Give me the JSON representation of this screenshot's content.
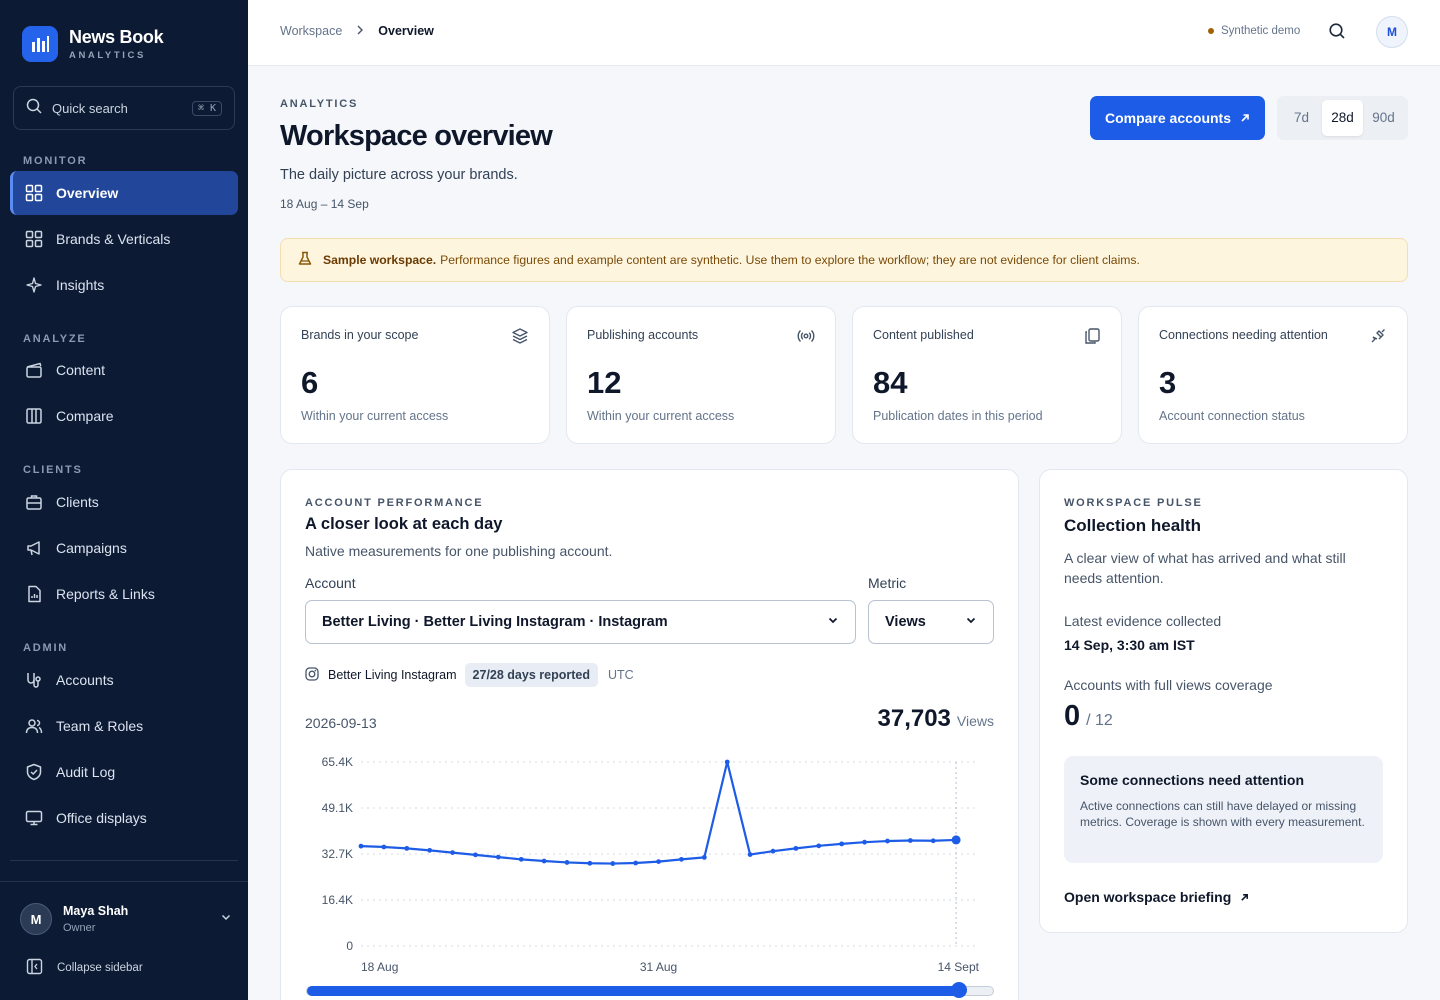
{
  "brand": {
    "name": "News Book",
    "tagline": "ANALYTICS"
  },
  "sidebar": {
    "search": {
      "label": "Quick search",
      "shortcut": "⌘ K"
    },
    "sections": {
      "monitor": "MONITOR",
      "analyze": "ANALYZE",
      "clients": "CLIENTS",
      "admin": "ADMIN"
    },
    "items": {
      "overview": "Overview",
      "brands": "Brands & Verticals",
      "insights": "Insights",
      "content": "Content",
      "compare": "Compare",
      "clients": "Clients",
      "campaigns": "Campaigns",
      "reports": "Reports & Links",
      "accounts": "Accounts",
      "team": "Team & Roles",
      "audit": "Audit Log",
      "displays": "Office displays"
    },
    "active_item": "overview",
    "user": {
      "initial": "M",
      "name": "Maya Shah",
      "role": "Owner"
    },
    "collapse_label": "Collapse sidebar"
  },
  "topbar": {
    "breadcrumb": [
      "Workspace",
      "Overview"
    ],
    "demo_badge": "Synthetic demo",
    "avatar_initial": "M"
  },
  "header": {
    "eyebrow": "ANALYTICS",
    "title": "Workspace overview",
    "subtitle": "The daily picture across your brands.",
    "date_range": "18 Aug – 14 Sep",
    "compare_button": "Compare accounts",
    "ranges": [
      "7d",
      "28d",
      "90d"
    ],
    "selected_range": "28d"
  },
  "notice": {
    "bold": "Sample workspace.",
    "text": "Performance figures and example content are synthetic. Use them to explore the workflow; they are not evidence for client claims."
  },
  "stats": [
    {
      "label": "Brands in your scope",
      "value": "6",
      "note": "Within your current access",
      "icon": "layers-icon"
    },
    {
      "label": "Publishing accounts",
      "value": "12",
      "note": "Within your current access",
      "icon": "broadcast-icon"
    },
    {
      "label": "Content published",
      "value": "84",
      "note": "Publication dates in this period",
      "icon": "copy-icon"
    },
    {
      "label": "Connections needing attention",
      "value": "3",
      "note": "Account connection status",
      "icon": "unplug-icon"
    }
  ],
  "performance": {
    "eyebrow": "ACCOUNT PERFORMANCE",
    "title": "A closer look at each day",
    "subtitle": "Native measurements for one publishing account.",
    "account_label": "Account",
    "account_value": "Better Living · Better Living Instagram · Instagram",
    "metric_label": "Metric",
    "metric_value": "Views",
    "account_name": "Better Living Instagram",
    "days_badge": "27/28 days reported",
    "timezone": "UTC",
    "selected_date": "2026-09-13",
    "selected_value": "37,703",
    "selected_unit": "Views",
    "slider_position": 0.95
  },
  "chart_data": {
    "type": "line",
    "y_ticks": [
      "65.4K",
      "49.1K",
      "32.7K",
      "16.4K",
      "0"
    ],
    "ylim": [
      0,
      65400
    ],
    "x_ticks": [
      "18 Aug",
      "31 Aug",
      "14 Sept"
    ],
    "x": [
      "18 Aug",
      "19 Aug",
      "20 Aug",
      "21 Aug",
      "22 Aug",
      "23 Aug",
      "24 Aug",
      "25 Aug",
      "26 Aug",
      "27 Aug",
      "28 Aug",
      "29 Aug",
      "30 Aug",
      "31 Aug",
      "1 Sep",
      "2 Sep",
      "3 Sep",
      "4 Sep",
      "5 Sep",
      "6 Sep",
      "7 Sep",
      "8 Sep",
      "9 Sep",
      "10 Sep",
      "11 Sep",
      "12 Sep",
      "13 Sep"
    ],
    "series": [
      {
        "values": [
          35500,
          35200,
          34700,
          34000,
          33200,
          32400,
          31600,
          30800,
          30200,
          29700,
          29400,
          29300,
          29500,
          30000,
          30800,
          31500,
          65400,
          32500,
          33700,
          34700,
          35600,
          36300,
          36900,
          37300,
          37500,
          37400,
          37703
        ]
      }
    ],
    "color": "#1d5ce6",
    "highlight_index": 26,
    "grid": true
  },
  "pulse": {
    "eyebrow": "WORKSPACE PULSE",
    "title": "Collection health",
    "description": "A clear view of what has arrived and what still needs attention.",
    "latest_label": "Latest evidence collected",
    "latest_value": "14 Sep, 3:30 am IST",
    "coverage_label": "Accounts with full views coverage",
    "coverage_num": "0",
    "coverage_den": "/ 12",
    "attention_title": "Some connections need attention",
    "attention_body": "Active connections can still have delayed or missing metrics. Coverage is shown with every measurement.",
    "briefing_link": "Open workspace briefing"
  },
  "colors": {
    "accent": "#1d5ce6",
    "sidebar": "#0c1a33",
    "notice_bg": "#fef5df"
  }
}
